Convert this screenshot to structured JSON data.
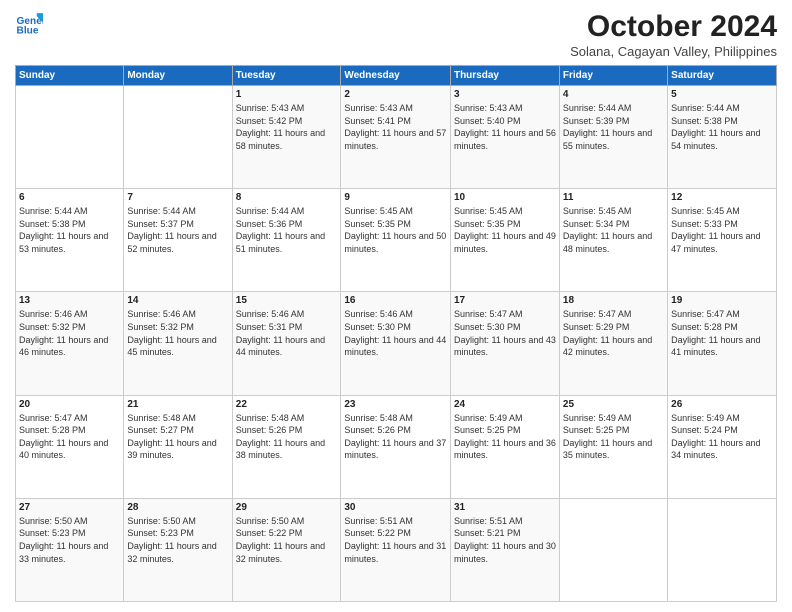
{
  "logo": {
    "line1": "General",
    "line2": "Blue"
  },
  "title": "October 2024",
  "location": "Solana, Cagayan Valley, Philippines",
  "weekdays": [
    "Sunday",
    "Monday",
    "Tuesday",
    "Wednesday",
    "Thursday",
    "Friday",
    "Saturday"
  ],
  "weeks": [
    [
      {
        "day": "",
        "sunrise": "",
        "sunset": "",
        "daylight": ""
      },
      {
        "day": "",
        "sunrise": "",
        "sunset": "",
        "daylight": ""
      },
      {
        "day": "1",
        "sunrise": "Sunrise: 5:43 AM",
        "sunset": "Sunset: 5:42 PM",
        "daylight": "Daylight: 11 hours and 58 minutes."
      },
      {
        "day": "2",
        "sunrise": "Sunrise: 5:43 AM",
        "sunset": "Sunset: 5:41 PM",
        "daylight": "Daylight: 11 hours and 57 minutes."
      },
      {
        "day": "3",
        "sunrise": "Sunrise: 5:43 AM",
        "sunset": "Sunset: 5:40 PM",
        "daylight": "Daylight: 11 hours and 56 minutes."
      },
      {
        "day": "4",
        "sunrise": "Sunrise: 5:44 AM",
        "sunset": "Sunset: 5:39 PM",
        "daylight": "Daylight: 11 hours and 55 minutes."
      },
      {
        "day": "5",
        "sunrise": "Sunrise: 5:44 AM",
        "sunset": "Sunset: 5:38 PM",
        "daylight": "Daylight: 11 hours and 54 minutes."
      }
    ],
    [
      {
        "day": "6",
        "sunrise": "Sunrise: 5:44 AM",
        "sunset": "Sunset: 5:38 PM",
        "daylight": "Daylight: 11 hours and 53 minutes."
      },
      {
        "day": "7",
        "sunrise": "Sunrise: 5:44 AM",
        "sunset": "Sunset: 5:37 PM",
        "daylight": "Daylight: 11 hours and 52 minutes."
      },
      {
        "day": "8",
        "sunrise": "Sunrise: 5:44 AM",
        "sunset": "Sunset: 5:36 PM",
        "daylight": "Daylight: 11 hours and 51 minutes."
      },
      {
        "day": "9",
        "sunrise": "Sunrise: 5:45 AM",
        "sunset": "Sunset: 5:35 PM",
        "daylight": "Daylight: 11 hours and 50 minutes."
      },
      {
        "day": "10",
        "sunrise": "Sunrise: 5:45 AM",
        "sunset": "Sunset: 5:35 PM",
        "daylight": "Daylight: 11 hours and 49 minutes."
      },
      {
        "day": "11",
        "sunrise": "Sunrise: 5:45 AM",
        "sunset": "Sunset: 5:34 PM",
        "daylight": "Daylight: 11 hours and 48 minutes."
      },
      {
        "day": "12",
        "sunrise": "Sunrise: 5:45 AM",
        "sunset": "Sunset: 5:33 PM",
        "daylight": "Daylight: 11 hours and 47 minutes."
      }
    ],
    [
      {
        "day": "13",
        "sunrise": "Sunrise: 5:46 AM",
        "sunset": "Sunset: 5:32 PM",
        "daylight": "Daylight: 11 hours and 46 minutes."
      },
      {
        "day": "14",
        "sunrise": "Sunrise: 5:46 AM",
        "sunset": "Sunset: 5:32 PM",
        "daylight": "Daylight: 11 hours and 45 minutes."
      },
      {
        "day": "15",
        "sunrise": "Sunrise: 5:46 AM",
        "sunset": "Sunset: 5:31 PM",
        "daylight": "Daylight: 11 hours and 44 minutes."
      },
      {
        "day": "16",
        "sunrise": "Sunrise: 5:46 AM",
        "sunset": "Sunset: 5:30 PM",
        "daylight": "Daylight: 11 hours and 44 minutes."
      },
      {
        "day": "17",
        "sunrise": "Sunrise: 5:47 AM",
        "sunset": "Sunset: 5:30 PM",
        "daylight": "Daylight: 11 hours and 43 minutes."
      },
      {
        "day": "18",
        "sunrise": "Sunrise: 5:47 AM",
        "sunset": "Sunset: 5:29 PM",
        "daylight": "Daylight: 11 hours and 42 minutes."
      },
      {
        "day": "19",
        "sunrise": "Sunrise: 5:47 AM",
        "sunset": "Sunset: 5:28 PM",
        "daylight": "Daylight: 11 hours and 41 minutes."
      }
    ],
    [
      {
        "day": "20",
        "sunrise": "Sunrise: 5:47 AM",
        "sunset": "Sunset: 5:28 PM",
        "daylight": "Daylight: 11 hours and 40 minutes."
      },
      {
        "day": "21",
        "sunrise": "Sunrise: 5:48 AM",
        "sunset": "Sunset: 5:27 PM",
        "daylight": "Daylight: 11 hours and 39 minutes."
      },
      {
        "day": "22",
        "sunrise": "Sunrise: 5:48 AM",
        "sunset": "Sunset: 5:26 PM",
        "daylight": "Daylight: 11 hours and 38 minutes."
      },
      {
        "day": "23",
        "sunrise": "Sunrise: 5:48 AM",
        "sunset": "Sunset: 5:26 PM",
        "daylight": "Daylight: 11 hours and 37 minutes."
      },
      {
        "day": "24",
        "sunrise": "Sunrise: 5:49 AM",
        "sunset": "Sunset: 5:25 PM",
        "daylight": "Daylight: 11 hours and 36 minutes."
      },
      {
        "day": "25",
        "sunrise": "Sunrise: 5:49 AM",
        "sunset": "Sunset: 5:25 PM",
        "daylight": "Daylight: 11 hours and 35 minutes."
      },
      {
        "day": "26",
        "sunrise": "Sunrise: 5:49 AM",
        "sunset": "Sunset: 5:24 PM",
        "daylight": "Daylight: 11 hours and 34 minutes."
      }
    ],
    [
      {
        "day": "27",
        "sunrise": "Sunrise: 5:50 AM",
        "sunset": "Sunset: 5:23 PM",
        "daylight": "Daylight: 11 hours and 33 minutes."
      },
      {
        "day": "28",
        "sunrise": "Sunrise: 5:50 AM",
        "sunset": "Sunset: 5:23 PM",
        "daylight": "Daylight: 11 hours and 32 minutes."
      },
      {
        "day": "29",
        "sunrise": "Sunrise: 5:50 AM",
        "sunset": "Sunset: 5:22 PM",
        "daylight": "Daylight: 11 hours and 32 minutes."
      },
      {
        "day": "30",
        "sunrise": "Sunrise: 5:51 AM",
        "sunset": "Sunset: 5:22 PM",
        "daylight": "Daylight: 11 hours and 31 minutes."
      },
      {
        "day": "31",
        "sunrise": "Sunrise: 5:51 AM",
        "sunset": "Sunset: 5:21 PM",
        "daylight": "Daylight: 11 hours and 30 minutes."
      },
      {
        "day": "",
        "sunrise": "",
        "sunset": "",
        "daylight": ""
      },
      {
        "day": "",
        "sunrise": "",
        "sunset": "",
        "daylight": ""
      }
    ]
  ]
}
